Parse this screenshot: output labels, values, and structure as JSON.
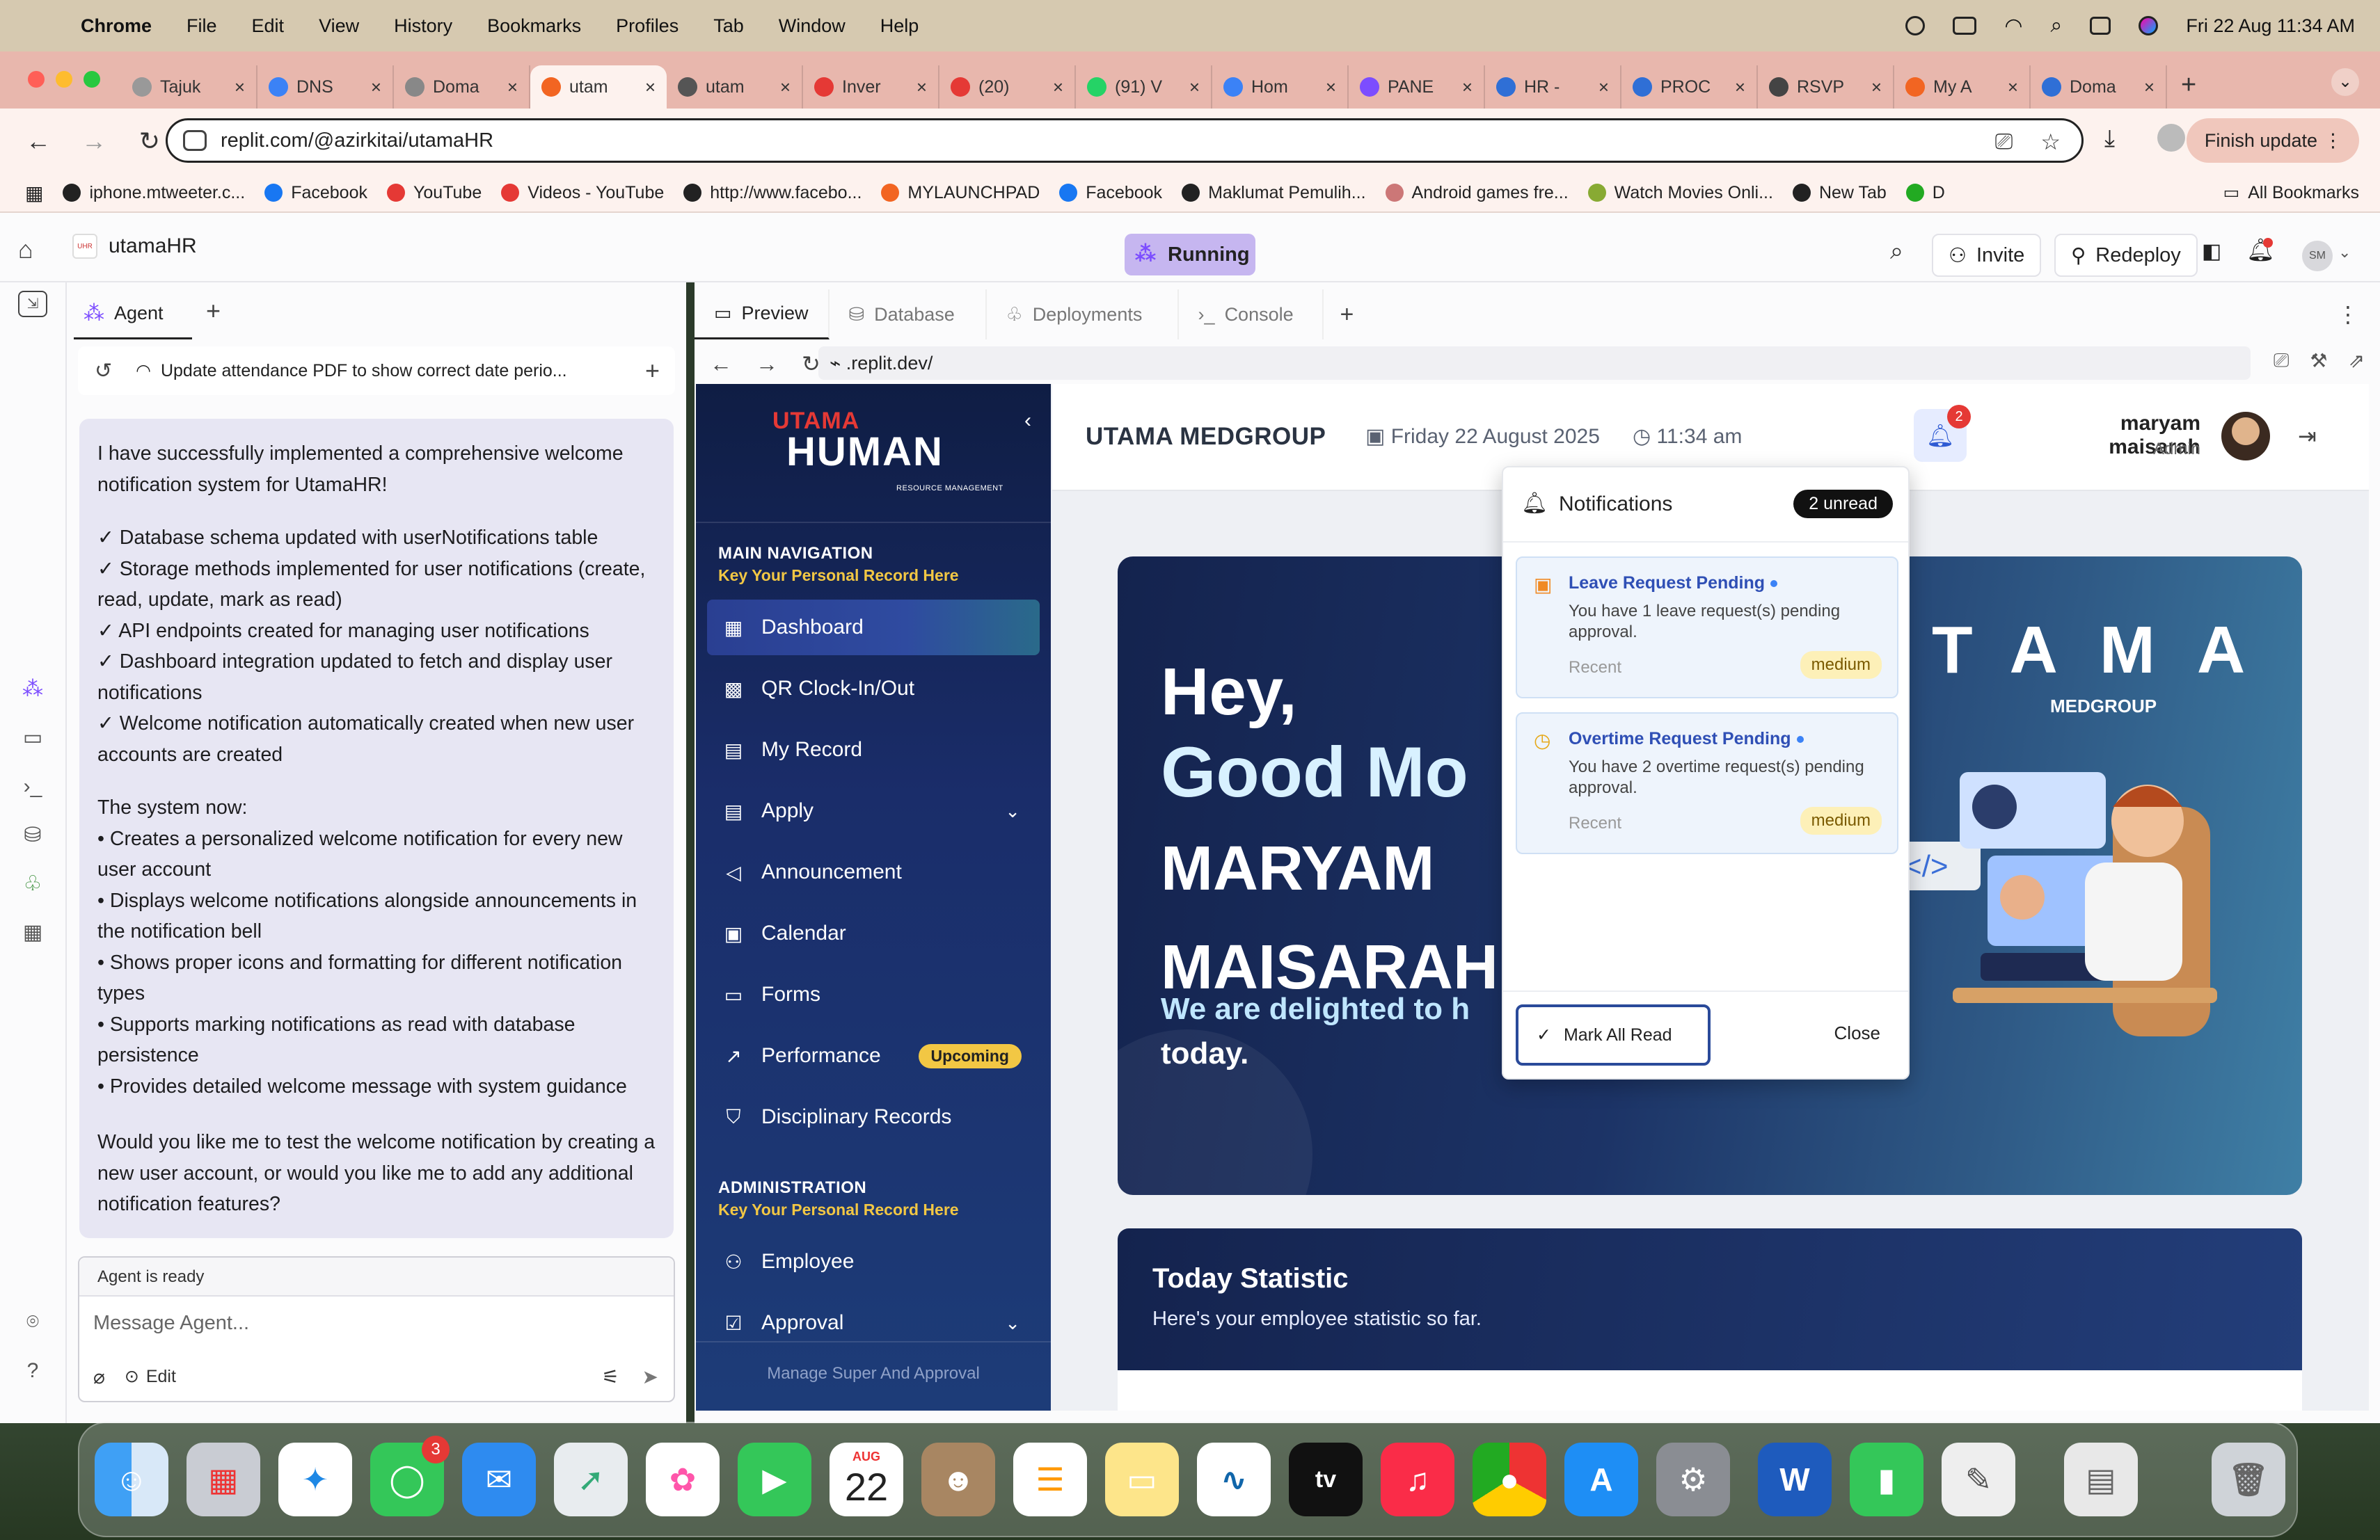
{
  "menubar": {
    "app": "Chrome",
    "items": [
      "File",
      "Edit",
      "View",
      "History",
      "Bookmarks",
      "Profiles",
      "Tab",
      "Window",
      "Help"
    ],
    "datetime": "Fri 22 Aug  11:34 AM"
  },
  "tabs": [
    {
      "label": "Tajuk",
      "color": "#999"
    },
    {
      "label": "DNS",
      "color": "#3b82f6"
    },
    {
      "label": "Doma",
      "color": "#888"
    },
    {
      "label": "utam",
      "color": "#f26522",
      "active": true
    },
    {
      "label": "utam",
      "color": "#555"
    },
    {
      "label": "Inver",
      "color": "#e53935"
    },
    {
      "label": "(20)",
      "color": "#e53935"
    },
    {
      "label": "(91) V",
      "color": "#25d366"
    },
    {
      "label": "Hom",
      "color": "#3b82f6"
    },
    {
      "label": "PANE",
      "color": "#7c4dff"
    },
    {
      "label": "HR -",
      "color": "#2f6fd6"
    },
    {
      "label": "PROC",
      "color": "#2f6fd6"
    },
    {
      "label": "RSVP",
      "color": "#444"
    },
    {
      "label": "My A",
      "color": "#f26522"
    },
    {
      "label": "Doma",
      "color": "#2f6fd6"
    }
  ],
  "address": {
    "url": "replit.com/@azirkitai/utamaHR",
    "finish_update": "Finish update"
  },
  "bookmarks": [
    "iphone.mtweeter.c...",
    "Facebook",
    "YouTube",
    "Videos - YouTube",
    "http://www.facebo...",
    "MYLAUNCHPAD",
    "Facebook",
    "Maklumat Pemulih...",
    "Android games fre...",
    "Watch Movies Onli...",
    "New Tab",
    "D"
  ],
  "all_bookmarks": "All Bookmarks",
  "replit": {
    "project": "utamaHR",
    "status": "Running",
    "invite": "Invite",
    "redeploy": "Redeploy",
    "avatar": "SM"
  },
  "agent": {
    "tab": "Agent",
    "history_title": "Update attendance PDF to show correct date perio...",
    "message": {
      "intro": "I have successfully implemented a comprehensive welcome notification system for UtamaHR!",
      "checks": [
        "✓ Database schema updated with userNotifications table",
        "✓ Storage methods implemented for user notifications (create, read, update, mark as read)",
        "✓ API endpoints created for managing user notifications",
        "✓ Dashboard integration updated to fetch and display user notifications",
        "✓ Welcome notification automatically created when new user accounts are created"
      ],
      "now_title": "The system now:",
      "bullets": [
        "• Creates a personalized welcome notification for every new user account",
        "• Displays welcome notifications alongside announcements in the notification bell",
        "• Shows proper icons and formatting for different notification types",
        "• Supports marking notifications as read with database persistence",
        "• Provides detailed welcome message with system guidance"
      ],
      "question": "Would you like me to test the welcome notification by creating a new user account, or would you like me to add any additional notification features?"
    },
    "status": "Agent is ready",
    "placeholder": "Message Agent...",
    "edit": "Edit"
  },
  "preview": {
    "tabs": [
      "Preview",
      "Database",
      "Deployments",
      "Console"
    ],
    "url": ".replit.dev/"
  },
  "app": {
    "logo_top": "UTAMA",
    "logo_main": "HUMAN",
    "logo_sub": "RESOURCE MANAGEMENT",
    "main_nav": "MAIN NAVIGATION",
    "main_nav_sub": "Key Your Personal Record Here",
    "nav": [
      "Dashboard",
      "QR Clock-In/Out",
      "My Record",
      "Apply",
      "Announcement",
      "Calendar",
      "Forms",
      "Performance",
      "Disciplinary Records"
    ],
    "upcoming": "Upcoming",
    "admin": "ADMINISTRATION",
    "admin_sub": "Key Your Personal Record Here",
    "admin_nav": [
      "Employee",
      "Approval"
    ],
    "footer": "Manage Super And Approval",
    "org": "UTAMA MEDGROUP",
    "date": "Friday 22 August 2025",
    "time": "11:34 am",
    "bell_count": "2",
    "user": "maryam maisarah",
    "role": "Admin",
    "hero": {
      "hey": "Hey,",
      "greeting": "Good Mo",
      "name": "MARYAM MAISARAH!",
      "line1": "We are delighted to h",
      "line2": "today.",
      "brand_big": "TAMA",
      "brand_sub": "MEDGROUP"
    },
    "stat": {
      "title": "Today Statistic",
      "subtitle": "Here's your employee statistic so far."
    },
    "notifications": {
      "title": "Notifications",
      "unread": "2 unread",
      "items": [
        {
          "title": "Leave Request Pending",
          "body": "You have 1 leave request(s) pending approval.",
          "time": "Recent",
          "priority": "medium"
        },
        {
          "title": "Overtime Request Pending",
          "body": "You have 2 overtime request(s) pending approval.",
          "time": "Recent",
          "priority": "medium"
        }
      ],
      "mark_all": "Mark All Read",
      "close": "Close"
    }
  },
  "dock": {
    "messages_badge": "3",
    "calendar_month": "AUG",
    "calendar_day": "22"
  }
}
